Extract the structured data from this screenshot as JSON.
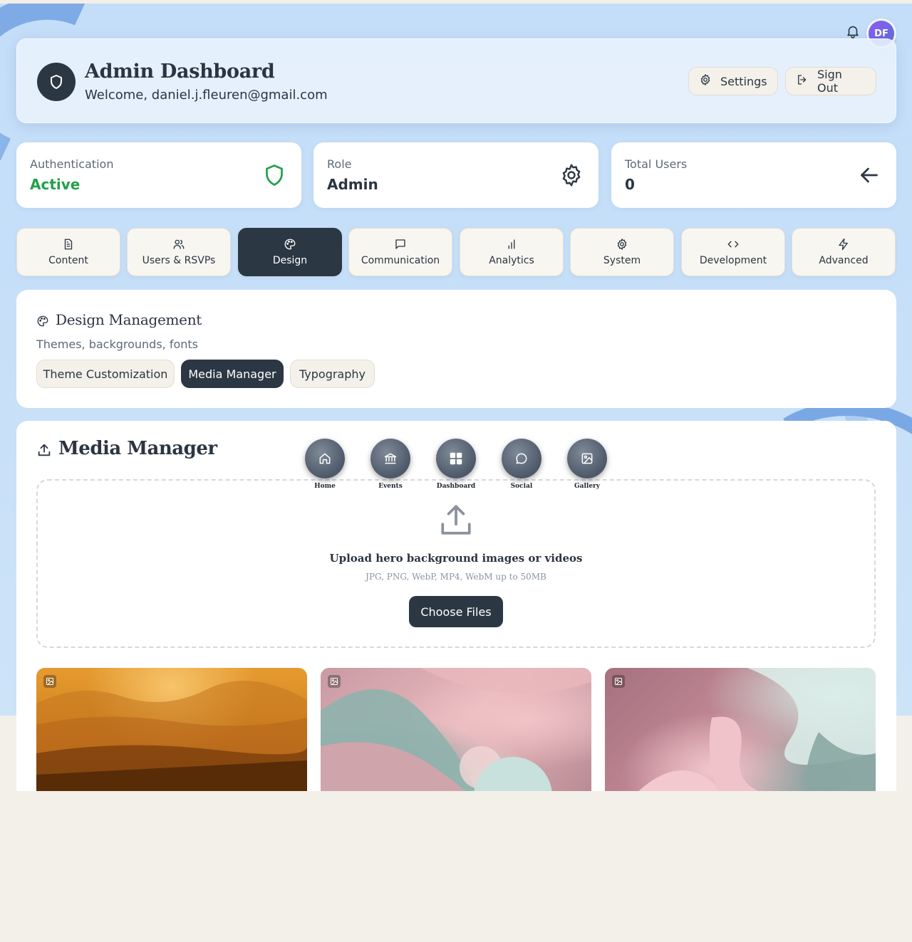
{
  "header": {
    "title": "Admin Dashboard",
    "welcome": "Welcome, daniel.j.fleuren@gmail.com",
    "settings_label": "Settings",
    "signout_label": "Sign Out",
    "avatar_initials": "DF"
  },
  "stats": [
    {
      "label": "Authentication",
      "value": "Active",
      "icon": "shield-icon",
      "value_color": "#22a04a"
    },
    {
      "label": "Role",
      "value": "Admin",
      "icon": "gear-icon"
    },
    {
      "label": "Total Users",
      "value": "0",
      "icon": "arrow-left-icon"
    }
  ],
  "tabs": [
    {
      "label": "Content",
      "icon": "document-icon"
    },
    {
      "label": "Users & RSVPs",
      "icon": "users-icon"
    },
    {
      "label": "Design",
      "icon": "palette-icon",
      "active": true
    },
    {
      "label": "Communication",
      "icon": "message-icon"
    },
    {
      "label": "Analytics",
      "icon": "bar-chart-icon"
    },
    {
      "label": "System",
      "icon": "gear-icon"
    },
    {
      "label": "Development",
      "icon": "code-icon"
    },
    {
      "label": "Advanced",
      "icon": "lightning-icon"
    }
  ],
  "design": {
    "title": "Design Management",
    "subtitle": "Themes, backgrounds, fonts",
    "subtabs": [
      {
        "label": "Theme Customization"
      },
      {
        "label": "Media Manager",
        "active": true
      },
      {
        "label": "Typography"
      }
    ]
  },
  "media": {
    "title": "Media Manager",
    "upload_title": "Upload hero background images or videos",
    "upload_hint": "JPG, PNG, WebP, MP4, WebM up to 50MB",
    "choose_label": "Choose Files",
    "thumbnails": [
      {
        "icon": "image-icon",
        "description": "vineyard"
      },
      {
        "icon": "image-icon",
        "description": "abstract-pink"
      },
      {
        "icon": "image-icon",
        "description": "abstract-mint"
      }
    ]
  },
  "floating_nav": [
    {
      "label": "Home",
      "icon": "home-icon"
    },
    {
      "label": "Events",
      "icon": "bank-icon"
    },
    {
      "label": "Dashboard",
      "icon": "grid-icon"
    },
    {
      "label": "Social",
      "icon": "chat-icon"
    },
    {
      "label": "Gallery",
      "icon": "image-icon"
    }
  ],
  "colors": {
    "accent_dark": "#2c3744",
    "success": "#22a04a",
    "background_blue": "#c4def9",
    "background_cream": "#f3f0ea"
  }
}
